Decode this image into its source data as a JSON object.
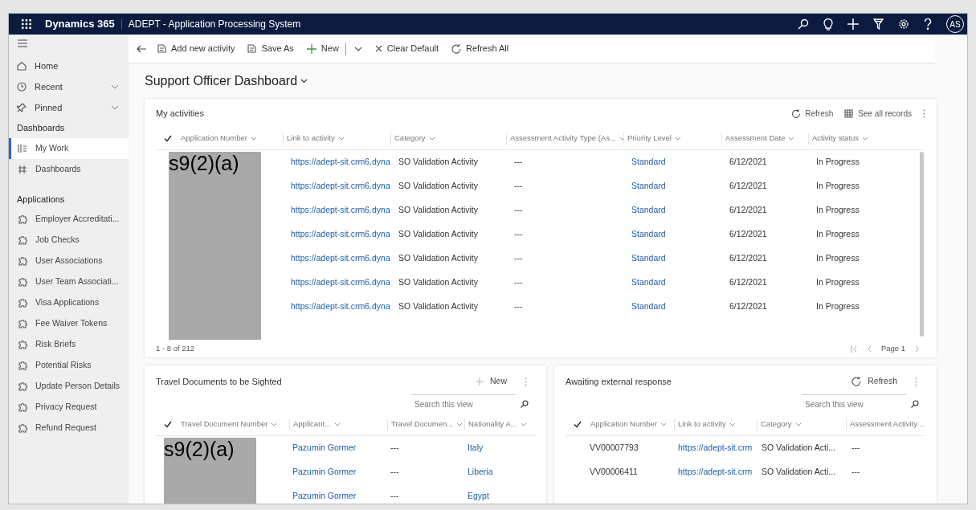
{
  "top_bar": {
    "app_name": "Dynamics 365",
    "title": "ADEPT - Application Processing System",
    "avatar": "AS"
  },
  "sidebar": {
    "nav": [
      {
        "label": "Home",
        "kind": "plain"
      },
      {
        "label": "Recent",
        "kind": "expandable"
      },
      {
        "label": "Pinned",
        "kind": "expandable"
      }
    ],
    "groups": [
      {
        "title": "Dashboards",
        "items": [
          {
            "label": "My Work",
            "selected": true
          },
          {
            "label": "Dashboards",
            "selected": false
          }
        ]
      },
      {
        "title": "Applications",
        "items": [
          {
            "label": "Employer Accreditati...",
            "selected": false
          },
          {
            "label": "Job Checks",
            "selected": false
          },
          {
            "label": "User Associations",
            "selected": false
          },
          {
            "label": "User Team Associati...",
            "selected": false
          },
          {
            "label": "Visa Applications",
            "selected": false
          },
          {
            "label": "Fee Waiver Tokens",
            "selected": false
          },
          {
            "label": "Risk Briefs",
            "selected": false
          },
          {
            "label": "Potential Risks",
            "selected": false
          },
          {
            "label": "Update Person Details",
            "selected": false
          },
          {
            "label": "Privacy Request",
            "selected": false
          },
          {
            "label": "Refund Request",
            "selected": false
          }
        ]
      }
    ]
  },
  "command_bar": [
    {
      "kind": "button",
      "label": "Add new activity"
    },
    {
      "kind": "button",
      "label": "Save As"
    },
    {
      "kind": "button",
      "label": "New"
    },
    {
      "kind": "dropdown"
    },
    {
      "kind": "button",
      "label": "Clear Default"
    },
    {
      "kind": "button",
      "label": "Refresh All"
    }
  ],
  "dashboard_title": "Support Officer Dashboard",
  "my_activities": {
    "title": "My activities",
    "actions": [
      "Refresh",
      "See all records"
    ],
    "columns": [
      "Application Number",
      "Link to activity",
      "Category",
      "Assessment Activity Type (As...",
      "Priority Level",
      "Assessment Date",
      "Activity status"
    ],
    "redaction": "s9(2)(a)",
    "rows": [
      [
        "",
        "https://adept-sit.crm6.dyna",
        "SO Validation Activity",
        "---",
        "Standard",
        "6/12/2021",
        "In Progress"
      ],
      [
        "",
        "https://adept-sit.crm6.dyna",
        "SO Validation Activity",
        "---",
        "Standard",
        "6/12/2021",
        "In Progress"
      ],
      [
        "",
        "https://adept-sit.crm6.dyna",
        "SO Validation Activity",
        "---",
        "Standard",
        "6/12/2021",
        "In Progress"
      ],
      [
        "",
        "https://adept-sit.crm6.dyna",
        "SO Validation Activity",
        "---",
        "Standard",
        "6/12/2021",
        "In Progress"
      ],
      [
        "",
        "https://adept-sit.crm6.dyna",
        "SO Validation Activity",
        "---",
        "Standard",
        "6/12/2021",
        "In Progress"
      ],
      [
        "",
        "https://adept-sit.crm6.dyna",
        "SO Validation Activity",
        "---",
        "Standard",
        "6/12/2021",
        "In Progress"
      ],
      [
        "",
        "https://adept-sit.crm6.dyna",
        "SO Validation Activity",
        "---",
        "Standard",
        "6/12/2021",
        "In Progress"
      ]
    ],
    "record_count": "1 - 8 of 212",
    "page": "Page 1"
  },
  "travel_documents": {
    "title": "Travel Documents to be Sighted",
    "action": "New",
    "search": {
      "placeholder": "Search this view"
    },
    "columns": [
      "Travel Document Number",
      "Applicant...",
      "Travel Documen...",
      "Nationality A..."
    ],
    "redaction": "s9(2)(a)",
    "rows": [
      [
        "",
        "Pazumin Gormer",
        "---",
        "Italy"
      ],
      [
        "",
        "Pazumin Gormer",
        "---",
        "Liberia"
      ],
      [
        "",
        "Pazumin Gormer",
        "---",
        "Egypt"
      ]
    ]
  },
  "awaiting": {
    "title": "Awaiting external response",
    "action": "Refresh",
    "search": {
      "placeholder": "Search this view"
    },
    "columns": [
      "Application Number",
      "Link to activity",
      "Category",
      "Assessment Activity ..."
    ],
    "rows": [
      [
        "VV00007793",
        "https://adept-sit.crm",
        "SO Validation Acti...",
        "---"
      ],
      [
        "VV00006411",
        "https://adept-sit.crm",
        "SO Validation Acti...",
        "---"
      ]
    ]
  }
}
